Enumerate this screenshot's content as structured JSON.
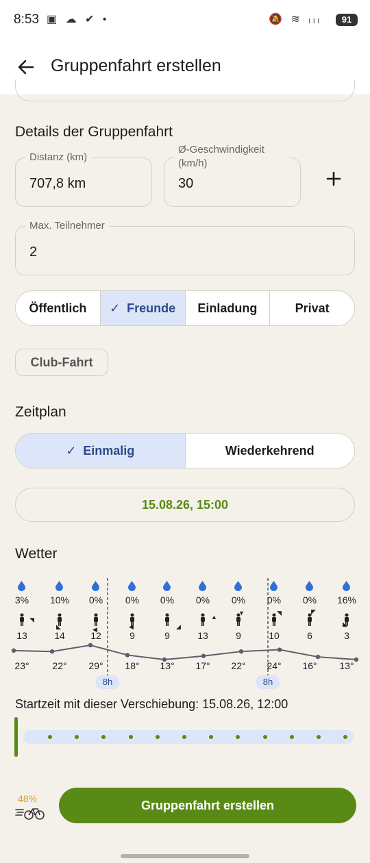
{
  "status_bar": {
    "time": "8:53",
    "left_icons": "▣ ☁ ✔ •",
    "right_icons": "🔕 ≋ ᵢᵢᵢ",
    "battery": "91"
  },
  "app_bar": {
    "title": "Gruppenfahrt erstellen",
    "back_icon": "arrow-left-icon"
  },
  "details": {
    "section_title": "Details der Gruppenfahrt",
    "distance": {
      "label": "Distanz (km)",
      "value": "707,8 km"
    },
    "speed": {
      "label": "Ø-Geschwindigkeit (km/h)",
      "value": "30"
    },
    "max_participants": {
      "label": "Max. Teilnehmer",
      "value": "2"
    },
    "visibility_options": [
      {
        "label": "Öffentlich",
        "active": false
      },
      {
        "label": "Freunde",
        "active": true
      },
      {
        "label": "Einladung",
        "active": false
      },
      {
        "label": "Privat",
        "active": false
      }
    ],
    "club_chip": "Club-Fahrt"
  },
  "schedule": {
    "section_title": "Zeitplan",
    "options": [
      {
        "label": "Einmalig",
        "active": true
      },
      {
        "label": "Wiederkehrend",
        "active": false
      }
    ],
    "datetime": "15.08.26, 15:00"
  },
  "weather": {
    "section_title": "Wetter",
    "precip": [
      "3%",
      "10%",
      "0%",
      "0%",
      "0%",
      "0%",
      "0%",
      "0%",
      "0%",
      "16%"
    ],
    "wind": [
      "13",
      "14",
      "12",
      "9",
      "9",
      "13",
      "9",
      "10",
      "6",
      "3"
    ],
    "temps": [
      23,
      22,
      29,
      18,
      13,
      17,
      22,
      24,
      16,
      13
    ],
    "temp_labels": [
      "23°",
      "22°",
      "29°",
      "18°",
      "13°",
      "17°",
      "22°",
      "24°",
      "16°",
      "13°"
    ],
    "hour_badges": [
      "8h",
      "8h"
    ],
    "colors": {
      "drop": "#2f6fd8",
      "line": "#5a5f6a"
    }
  },
  "shift": {
    "label": "Startzeit mit dieser Verschiebung: 15.08.26, 12:00"
  },
  "footer": {
    "battery_percent": "48%",
    "create_button": "Gruppenfahrt erstellen"
  },
  "colors": {
    "accent_green": "#5a8a16",
    "accent_blue_bg": "#dce6f8",
    "accent_blue_text": "#2d4a8a",
    "background": "#f4f1ea"
  }
}
